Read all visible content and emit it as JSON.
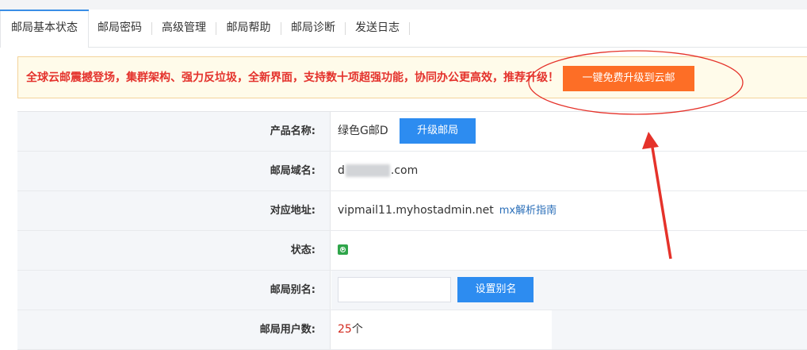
{
  "tabs": [
    {
      "label": "邮局基本状态",
      "active": true
    },
    {
      "label": "邮局密码",
      "active": false
    },
    {
      "label": "高级管理",
      "active": false
    },
    {
      "label": "邮局帮助",
      "active": false
    },
    {
      "label": "邮局诊断",
      "active": false
    },
    {
      "label": "发送日志",
      "active": false
    }
  ],
  "notice": {
    "text": "全球云邮震撼登场，集群架构、强力反垃圾，全新界面，支持数十项超强功能，协同办公更高效，推荐升级！",
    "button": "一键免费升级到云邮"
  },
  "info": {
    "product": {
      "label": "产品名称:",
      "value": "绿色G邮D",
      "button": "升级邮局"
    },
    "domain": {
      "label": "邮局域名:",
      "prefix": "d",
      "suffix": ".com"
    },
    "address": {
      "label": "对应地址:",
      "value": "vipmail11.myhostadmin.net",
      "link": "mx解析指南"
    },
    "status": {
      "label": "状态:",
      "icon": "status-play-icon"
    },
    "alias": {
      "label": "邮局别名:",
      "input_value": "",
      "button": "设置别名"
    },
    "users": {
      "label": "邮局用户数:",
      "count": "25",
      "unit": "个"
    }
  },
  "colors": {
    "accent_blue": "#2d8cf0",
    "notice_red": "#e4322c",
    "upgrade_orange": "#fd6e26",
    "annotation_red": "#e5322a",
    "status_green": "#2fa54a"
  }
}
